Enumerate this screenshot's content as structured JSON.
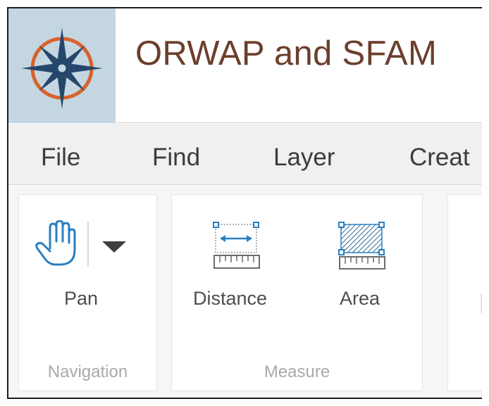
{
  "header": {
    "title": "ORWAP and SFAM",
    "logo_icon": "compass-rose-icon"
  },
  "menu": {
    "items": [
      "File",
      "Find",
      "Layer",
      "Creat"
    ]
  },
  "ribbon": {
    "navigation": {
      "label": "Navigation",
      "pan": {
        "label": "Pan",
        "icon": "hand-icon",
        "dropdown_icon": "caret-down-icon"
      }
    },
    "measure": {
      "label": "Measure",
      "distance": {
        "label": "Distance",
        "icon": "measure-distance-icon"
      },
      "area": {
        "label": "Area",
        "icon": "measure-area-icon"
      }
    }
  },
  "colors": {
    "logo_background": "#c4d6e2",
    "title": "#6b3f2c",
    "icon_blue": "#2a7fc0",
    "compass_orange": "#d9622b",
    "compass_navy": "#24476b"
  }
}
